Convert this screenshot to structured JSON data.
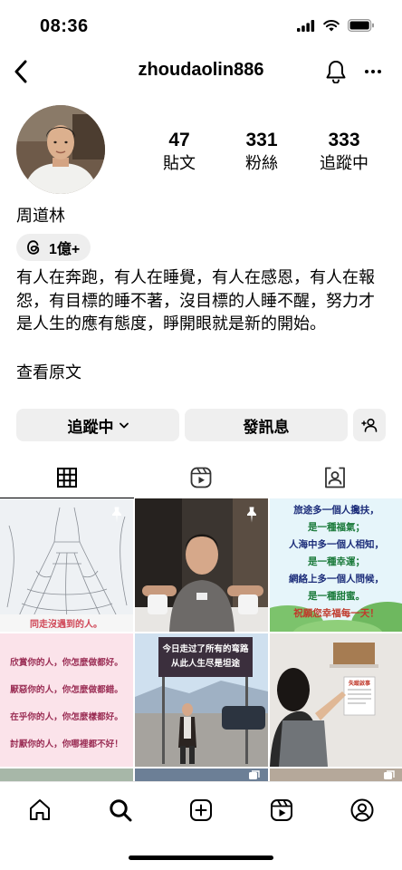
{
  "status_bar": {
    "time": "08:36"
  },
  "header": {
    "username": "zhoudaolin886"
  },
  "profile": {
    "name": "周道林",
    "threads_followers": "1億+",
    "stats": [
      {
        "count": "47",
        "label": "貼文"
      },
      {
        "count": "331",
        "label": "粉絲"
      },
      {
        "count": "333",
        "label": "追蹤中"
      }
    ],
    "bio": "有人在奔跑，有人在睡覺，有人在感恩，有人在報怨，有目標的睡不著，沒目標的人睡不醒，努力才是人生的應有態度，睜開眼就是新的開始。",
    "see_original": "查看原文"
  },
  "actions": {
    "following": "追蹤中",
    "message": "發訊息"
  },
  "tabs": [
    {
      "icon": "grid-icon",
      "active": true
    },
    {
      "icon": "reels-icon",
      "active": false
    },
    {
      "icon": "tagged-icon",
      "active": false
    }
  ],
  "posts": {
    "p1_caption": "同走沒遇到的人。",
    "p3_lines": [
      "旅途多一個人攙扶，",
      "是一種福氣；",
      "人海中多一個人相知，",
      "是一種幸運；",
      "網絡上多一個人問候，",
      "是一種甜蜜。",
      "祝願您幸福每一天！"
    ],
    "p4_lines": [
      "欣賞你的人，你怎麼做都好。",
      "厭惡你的人，你怎麼做都錯。",
      "在乎你的人，你怎麼樣都好。",
      "討厭你的人，你哪裡都不好！"
    ],
    "p5_sign": [
      "今日走过了所有的弯路",
      "从此人生尽是坦途"
    ],
    "p6_notice": "失蹤啟事"
  },
  "bottom_nav": [
    "home-icon",
    "search-icon",
    "create-icon",
    "reels-icon",
    "profile-icon"
  ]
}
